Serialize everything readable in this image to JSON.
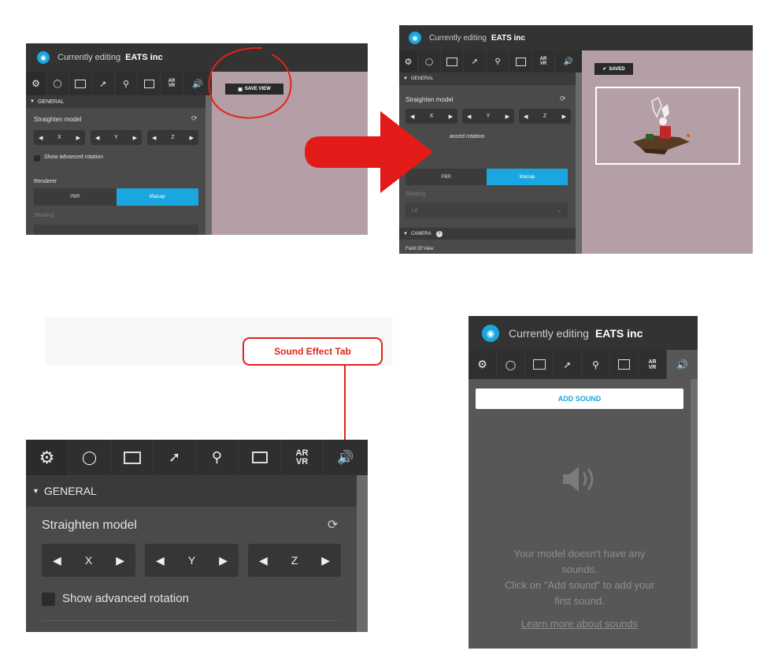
{
  "header": {
    "prefix": "Currently editing",
    "project": "EATS inc"
  },
  "tabs": [
    "settings-icon",
    "bulb-icon",
    "image-icon",
    "wand-icon",
    "pin-icon",
    "film-icon",
    "ar-vr-tab",
    "sound-icon"
  ],
  "ar_vr_label_top": "AR",
  "ar_vr_label_bottom": "VR",
  "general": {
    "section_title": "GENERAL",
    "straighten_label": "Straighten model",
    "axis_x": "X",
    "axis_y": "Y",
    "axis_z": "Z",
    "advanced_rotation": "Show advanced rotation",
    "renderer_label": "Renderer",
    "renderer_pbr": "PBR",
    "renderer_matcap": "Matcap",
    "shading_label": "Shading",
    "shading_value": "Lit",
    "partial_rotation": "anced rotation",
    "camera_label": "CAMERA",
    "fov_label": "Field Of View"
  },
  "save_view_button": "SAVE VIEW",
  "saved_badge": "SAVED",
  "callout_label": "Sound Effect Tab",
  "sound_panel": {
    "add_sound_button": "ADD SOUND",
    "empty_line1": "Your model doesn't have any",
    "empty_line2": "sounds.",
    "empty_line3": "Click on \"Add sound\" to add your",
    "empty_line4": "first sound.",
    "learn_more": "Learn more about sounds"
  },
  "colors": {
    "accent_blue": "#1aa7df",
    "callout_red": "#e2231a",
    "canvas_pink": "#b49fa6"
  }
}
